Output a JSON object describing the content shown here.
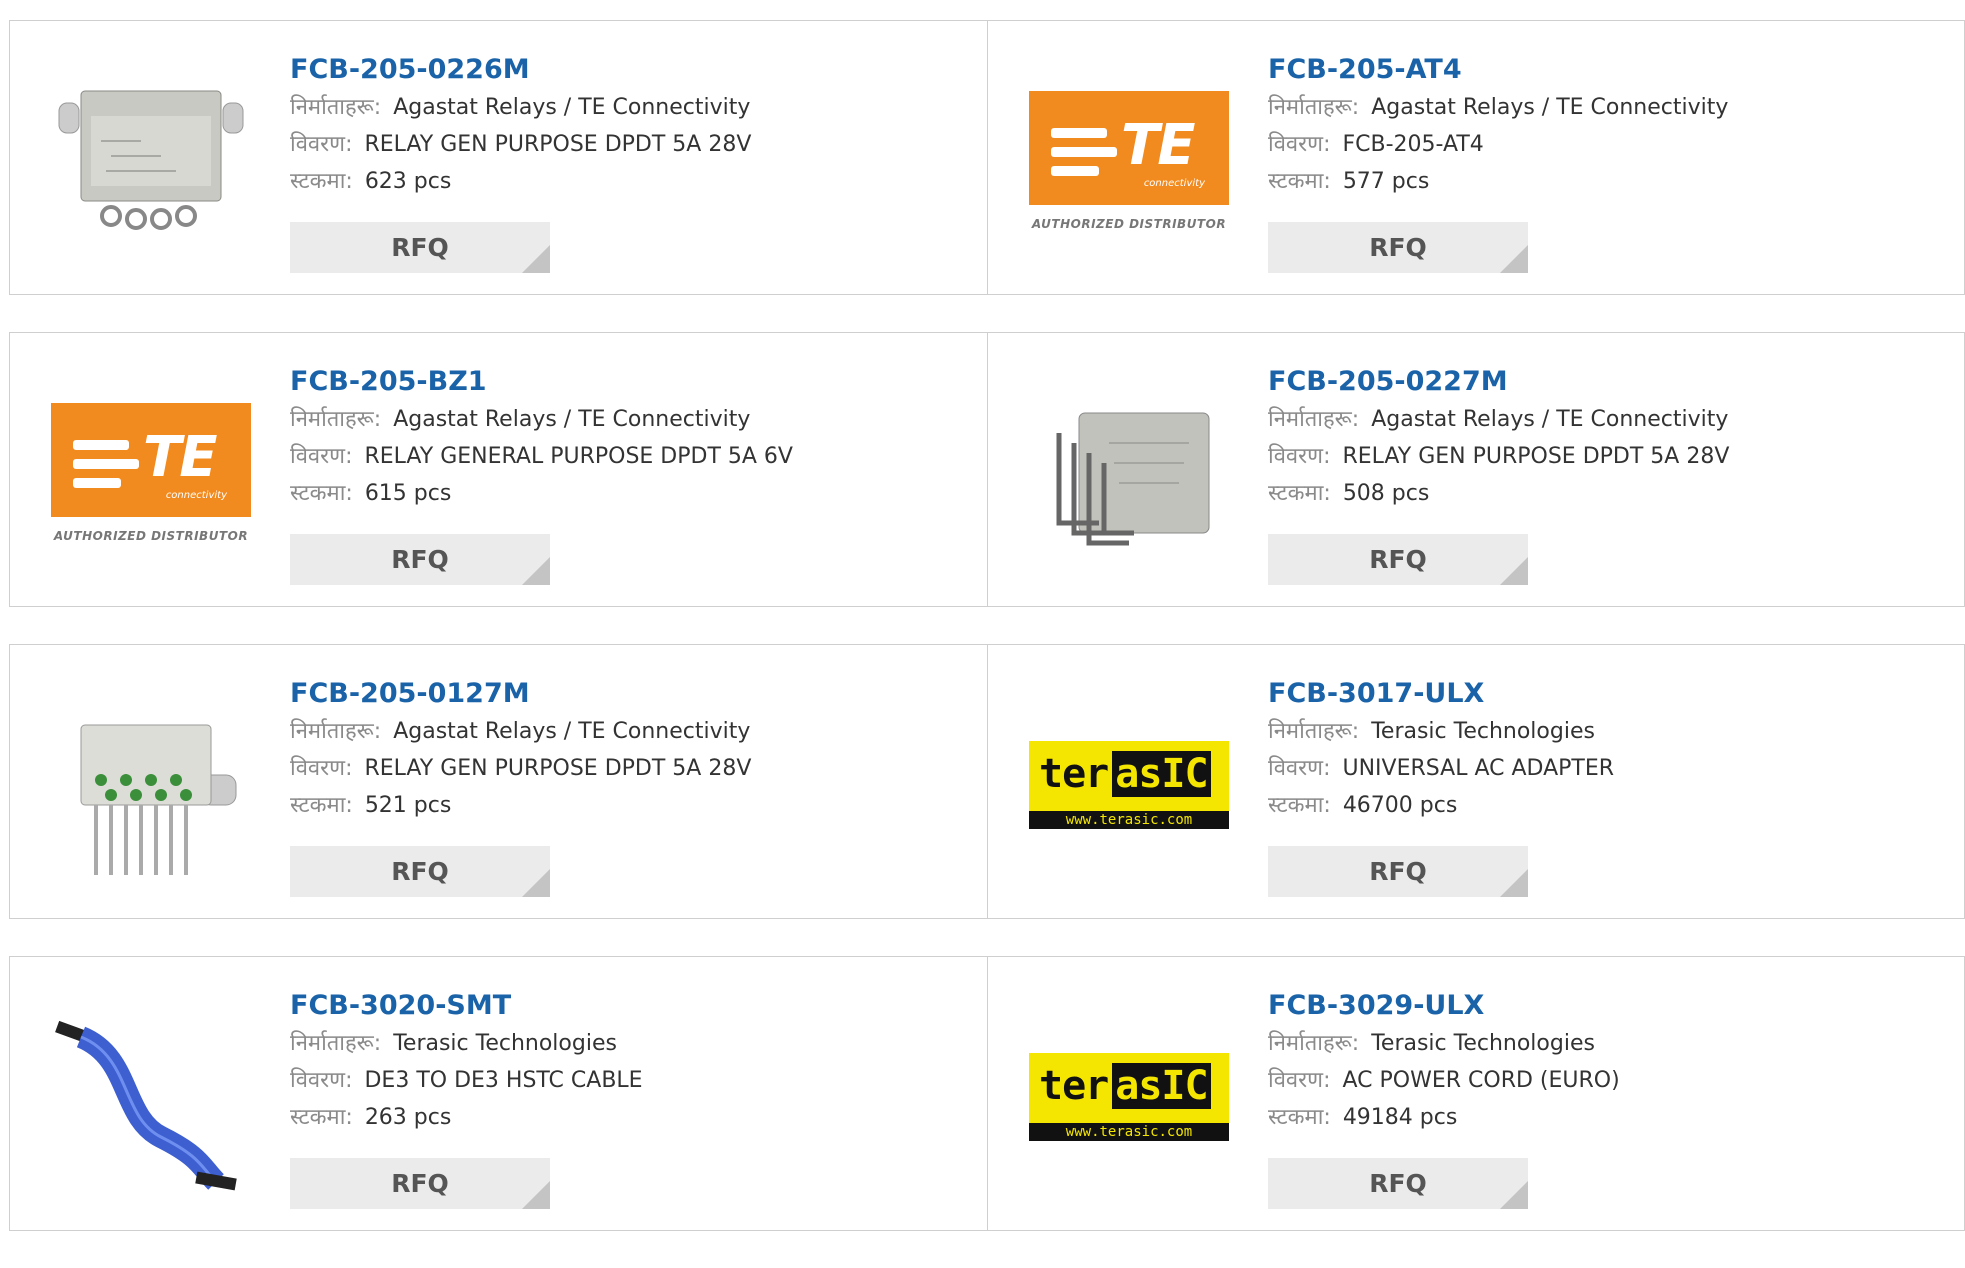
{
  "labels": {
    "manufacturer": "निर्माताहरू:",
    "description": "विवरण:",
    "stock": "स्टकमा:",
    "rfq": "RFQ"
  },
  "products": [
    {
      "part": "FCB-205-0226M",
      "manufacturer": "Agastat Relays / TE Connectivity",
      "description": "RELAY GEN PURPOSE DPDT 5A 28V",
      "stock": "623 pcs",
      "image": "relay-photo"
    },
    {
      "part": "FCB-205-AT4",
      "manufacturer": "Agastat Relays / TE Connectivity",
      "description": "FCB-205-AT4",
      "stock": "577 pcs",
      "image": "te-logo"
    },
    {
      "part": "FCB-205-BZ1",
      "manufacturer": "Agastat Relays / TE Connectivity",
      "description": "RELAY GENERAL PURPOSE DPDT 5A 6V",
      "stock": "615 pcs",
      "image": "te-logo"
    },
    {
      "part": "FCB-205-0227M",
      "manufacturer": "Agastat Relays / TE Connectivity",
      "description": "RELAY GEN PURPOSE DPDT 5A 28V",
      "stock": "508 pcs",
      "image": "relay-bent-pins-photo"
    },
    {
      "part": "FCB-205-0127M",
      "manufacturer": "Agastat Relays / TE Connectivity",
      "description": "RELAY GEN PURPOSE DPDT 5A 28V",
      "stock": "521 pcs",
      "image": "relay-pins-photo"
    },
    {
      "part": "FCB-3017-ULX",
      "manufacturer": "Terasic Technologies",
      "description": "UNIVERSAL AC ADAPTER",
      "stock": "46700 pcs",
      "image": "terasic-logo"
    },
    {
      "part": "FCB-3020-SMT",
      "manufacturer": "Terasic Technologies",
      "description": "DE3 TO DE3 HSTC CABLE",
      "stock": "263 pcs",
      "image": "ribbon-cable-photo"
    },
    {
      "part": "FCB-3029-ULX",
      "manufacturer": "Terasic Technologies",
      "description": "AC POWER CORD (EURO)",
      "stock": "49184 pcs",
      "image": "terasic-logo"
    }
  ],
  "logos": {
    "te_text": "TE",
    "te_sub": "connectivity",
    "te_auth": "AUTHORIZED DISTRIBUTOR",
    "terasic_a": "ter",
    "terasic_b": "asIC",
    "terasic_url": "www.terasic.com"
  },
  "colors": {
    "title": "#1a63a8",
    "te_orange": "#f28b1f",
    "terasic_yellow": "#f4e600"
  }
}
